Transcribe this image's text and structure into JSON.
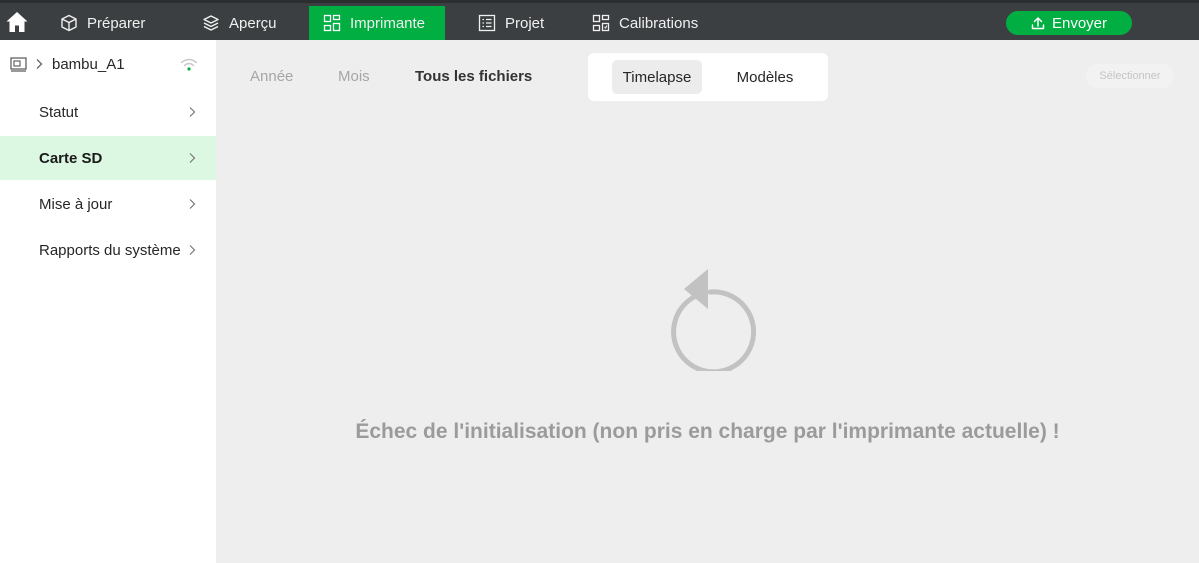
{
  "topbar": {
    "tabs": [
      {
        "label": "Préparer",
        "icon": "cube-icon"
      },
      {
        "label": "Aperçu",
        "icon": "layers-icon"
      },
      {
        "label": "Imprimante",
        "icon": "printer-icon",
        "active": true
      },
      {
        "label": "Projet",
        "icon": "list-icon"
      },
      {
        "label": "Calibrations",
        "icon": "calibration-icon"
      }
    ],
    "send_label": "Envoyer"
  },
  "sidebar": {
    "device_name": "bambu_A1",
    "items": [
      {
        "label": "Statut"
      },
      {
        "label": "Carte SD",
        "selected": true
      },
      {
        "label": "Mise à jour"
      },
      {
        "label": "Rapports du système"
      }
    ]
  },
  "main": {
    "filters": {
      "year": "Année",
      "month": "Mois",
      "all": "Tous les fichiers"
    },
    "segment": {
      "timelapse": "Timelapse",
      "models": "Modèles"
    },
    "select_label": "Sélectionner",
    "error_message": "Échec de l'initialisation (non pris en charge par l'imprimante actuelle) !"
  },
  "colors": {
    "accent": "#00ae42",
    "topbar": "#3c3f41",
    "selected_bg": "#dcf8e3",
    "content_bg": "#eeeeee"
  }
}
